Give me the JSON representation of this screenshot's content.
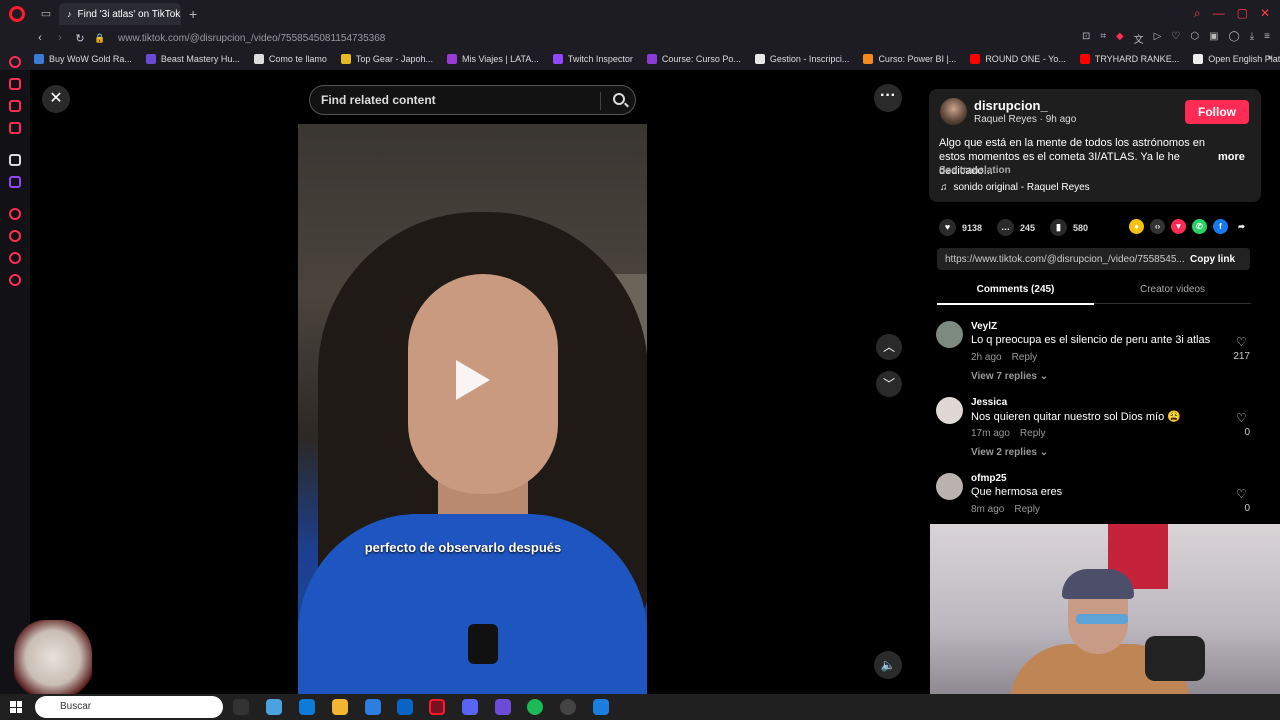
{
  "browser": {
    "tab_title": "Find '3i atlas' on TikTok |",
    "url_host": "www.tiktok.com",
    "url_path": "/@disrupcion_/video/7558545081154735368",
    "bookmarks": [
      {
        "label": "Buy WoW Gold Ra...",
        "color": "#3a7bd5"
      },
      {
        "label": "Beast Mastery Hu...",
        "color": "#6a4bd8"
      },
      {
        "label": "Como te llamo",
        "color": "#dddddd"
      },
      {
        "label": "Top Gear - Japoh...",
        "color": "#e8b923"
      },
      {
        "label": "Mis Viajes | LATA...",
        "color": "#9b3bd6"
      },
      {
        "label": "Twitch Inspector",
        "color": "#9147ff"
      },
      {
        "label": "Course: Curso Po...",
        "color": "#8b3ad6"
      },
      {
        "label": "Gestion - Inscripci...",
        "color": "#e8e8e8"
      },
      {
        "label": "Curso: Power BI |...",
        "color": "#f28a1e"
      },
      {
        "label": "ROUND ONE - Yo...",
        "color": "#ff0000"
      },
      {
        "label": "TRYHARD RANKE...",
        "color": "#ff0000"
      },
      {
        "label": "Open English Plat...",
        "color": "#eeeeee"
      }
    ]
  },
  "video_page": {
    "search_placeholder": "Find related content",
    "caption": "perfecto de observarlo después"
  },
  "creator": {
    "username": "disrupcion_",
    "display_name": "Raquel Reyes",
    "posted": "9h ago",
    "subline": "Raquel Reyes · 9h ago",
    "follow_label": "Follow",
    "description": "Algo que está en la mente de todos los astrónomos en estos momentos es el cometa 3I/ATLAS. Ya le he dedicado...",
    "more_label": "more",
    "see_translation": "See translation",
    "sound": "sonido original - Raquel Reyes"
  },
  "stats": {
    "likes": "9138",
    "comments": "245",
    "saves": "580"
  },
  "link": {
    "url": "https://www.tiktok.com/@disrupcion_/video/7558545...",
    "copy_label": "Copy link"
  },
  "tabs": {
    "comments": "Comments (245)",
    "creator_videos": "Creator videos"
  },
  "comments": [
    {
      "user": "VeylZ",
      "text": "Lo q preocupa es el silencio de peru ante 3i atlas",
      "time": "2h ago",
      "reply": "Reply",
      "likes": "217",
      "view_replies": "View 7 replies ⌄",
      "avatar_color": "#7d8a80"
    },
    {
      "user": "Jessica",
      "text": "Nos quieren quitar nuestro sol Dios mío 😩",
      "time": "17m ago",
      "reply": "Reply",
      "likes": "0",
      "view_replies": "View 2 replies ⌄",
      "avatar_color": "#e0d8d4"
    },
    {
      "user": "ofmp25",
      "text": "Que hermosa eres",
      "time": "8m ago",
      "reply": "Reply",
      "likes": "0",
      "view_replies": "",
      "avatar_color": "#b9b2ae"
    }
  ],
  "taskbar": {
    "search_label": "Buscar"
  }
}
